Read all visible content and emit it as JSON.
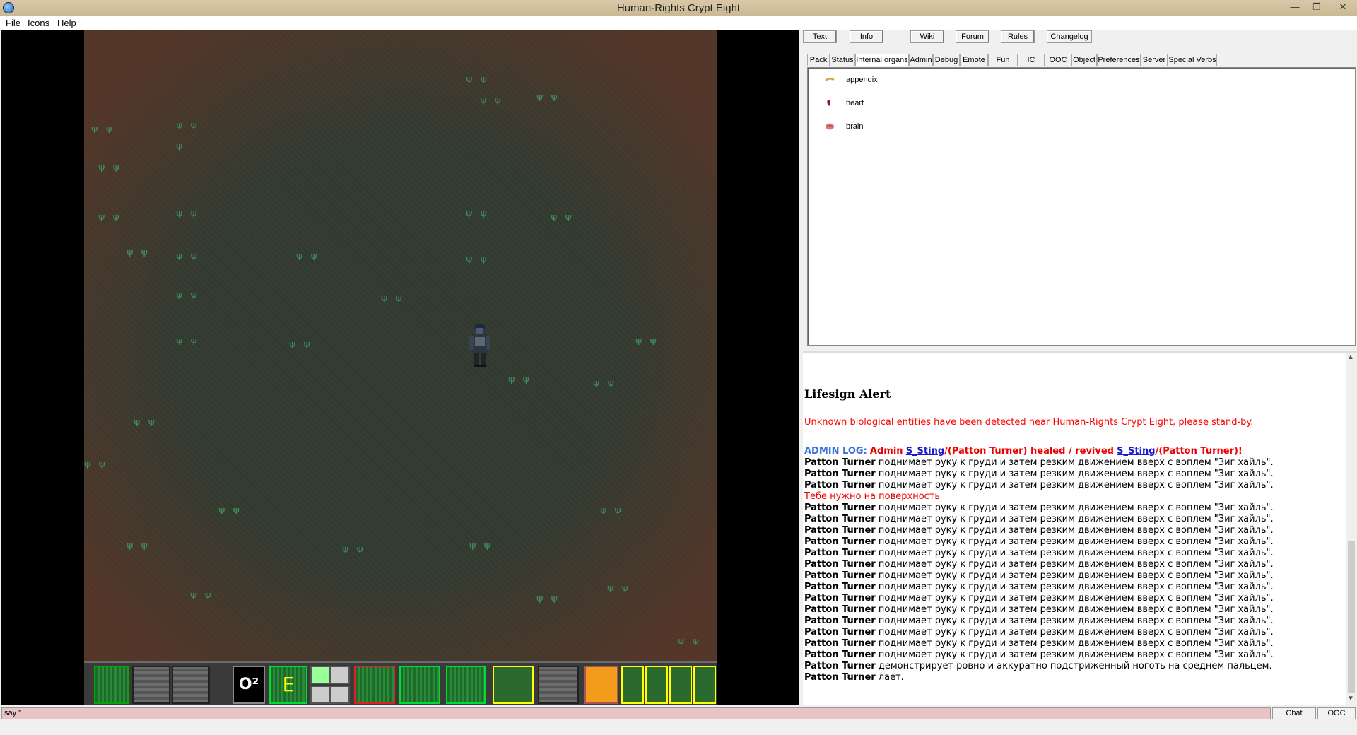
{
  "window": {
    "title": "Human-Rights Crypt Eight"
  },
  "menu": {
    "file": "File",
    "icons": "Icons",
    "help": "Help"
  },
  "top_buttons": [
    "Text",
    "Info",
    "Wiki",
    "Forum",
    "Rules",
    "Changelog"
  ],
  "tabs": [
    "Pack",
    "Status",
    "Internal organs",
    "Admin",
    "Debug",
    "Emote",
    "Fun",
    "IC",
    "OOC",
    "Object",
    "Preferences",
    "Server",
    "Special Verbs"
  ],
  "organs": [
    {
      "name": "appendix",
      "icon": "appendix-icon"
    },
    {
      "name": "heart",
      "icon": "heart-icon"
    },
    {
      "name": "brain",
      "icon": "brain-icon"
    }
  ],
  "output": {
    "heading": "Lifesign Alert",
    "alert": "Unknown biological entities have been detected near Human-Rights Crypt Eight, please stand-by.",
    "admin_log": {
      "prefix": "ADMIN LOG:",
      "admin": "Admin",
      "user1": "S_Sting",
      "mid": "/(Patton Turner) healed / revived",
      "user2": "S_Sting",
      "suffix": "/(Patton Turner)!"
    },
    "lines": [
      {
        "speaker": "Patton Turner",
        "text": "поднимает руку к груди и затем резким движением вверх с воплем \"Зиг хайль\"."
      },
      {
        "speaker": "Patton Turner",
        "text": "поднимает руку к груди и затем резким движением вверх с воплем \"Зиг хайль\"."
      },
      {
        "speaker": "Patton Turner",
        "text": "поднимает руку к груди и затем резким движением вверх с воплем \"Зиг хайль\"."
      },
      {
        "speaker": "",
        "text": "Тебе нужно на поверхность",
        "red": true
      },
      {
        "speaker": "Patton Turner",
        "text": "поднимает руку к груди и затем резким движением вверх с воплем \"Зиг хайль\"."
      },
      {
        "speaker": "Patton Turner",
        "text": "поднимает руку к груди и затем резким движением вверх с воплем \"Зиг хайль\"."
      },
      {
        "speaker": "Patton Turner",
        "text": "поднимает руку к груди и затем резким движением вверх с воплем \"Зиг хайль\"."
      },
      {
        "speaker": "Patton Turner",
        "text": "поднимает руку к груди и затем резким движением вверх с воплем \"Зиг хайль\"."
      },
      {
        "speaker": "Patton Turner",
        "text": "поднимает руку к груди и затем резким движением вверх с воплем \"Зиг хайль\"."
      },
      {
        "speaker": "Patton Turner",
        "text": "поднимает руку к груди и затем резким движением вверх с воплем \"Зиг хайль\"."
      },
      {
        "speaker": "Patton Turner",
        "text": "поднимает руку к груди и затем резким движением вверх с воплем \"Зиг хайль\"."
      },
      {
        "speaker": "Patton Turner",
        "text": "поднимает руку к груди и затем резким движением вверх с воплем \"Зиг хайль\"."
      },
      {
        "speaker": "Patton Turner",
        "text": "поднимает руку к груди и затем резким движением вверх с воплем \"Зиг хайль\"."
      },
      {
        "speaker": "Patton Turner",
        "text": "поднимает руку к груди и затем резким движением вверх с воплем \"Зиг хайль\"."
      },
      {
        "speaker": "Patton Turner",
        "text": "поднимает руку к груди и затем резким движением вверх с воплем \"Зиг хайль\"."
      },
      {
        "speaker": "Patton Turner",
        "text": "поднимает руку к груди и затем резким движением вверх с воплем \"Зиг хайль\"."
      },
      {
        "speaker": "Patton Turner",
        "text": "поднимает руку к груди и затем резким движением вверх с воплем \"Зиг хайль\"."
      },
      {
        "speaker": "Patton Turner",
        "text": "поднимает руку к груди и затем резким движением вверх с воплем \"Зиг хайль\"."
      },
      {
        "speaker": "Patton Turner",
        "text": "демонстрирует ровно и аккуратно подстриженный ноготь на среднем пальцем."
      },
      {
        "speaker": "Patton Turner",
        "text": "лает."
      }
    ]
  },
  "input": {
    "value": "say \"",
    "chat_label": "Chat",
    "ooc_label": "OOC"
  },
  "hud": {
    "oxygen_label": "O²",
    "internals_label": "E"
  }
}
